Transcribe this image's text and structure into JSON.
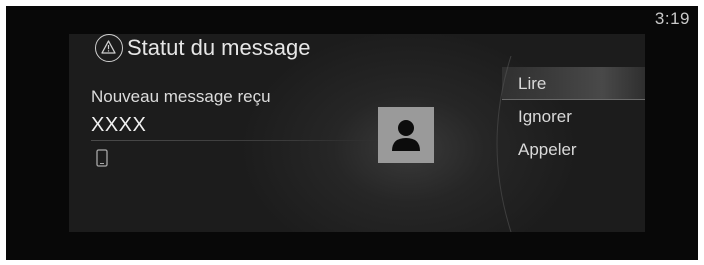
{
  "status_bar": {
    "time": "3:19"
  },
  "dialog": {
    "title": "Statut du message",
    "title_icon": "warning-icon",
    "notification_label": "Nouveau message reçu",
    "sender": "XXXX",
    "source_icon": "phone-icon",
    "avatar_icon": "contact-avatar-icon"
  },
  "menu": {
    "items": [
      {
        "label": "Lire",
        "selected": true
      },
      {
        "label": "Ignorer",
        "selected": false
      },
      {
        "label": "Appeler",
        "selected": false
      }
    ]
  },
  "colors": {
    "screen_bg": "#080808",
    "panel_bg": "#262626",
    "text": "#e6e6e6",
    "avatar_bg": "#9a9a9a"
  }
}
